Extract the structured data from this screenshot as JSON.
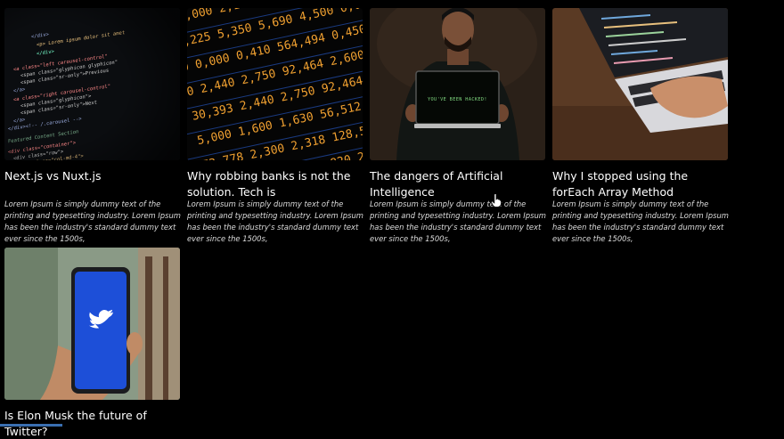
{
  "posts": [
    {
      "title": "Next.js vs Nuxt.js",
      "excerpt": "Lorem Ipsum is simply dummy text of the printing and typesetting industry. Lorem Ipsum has been the industry's standard dummy text ever since the 1500s,",
      "image": "code-editor-screenshot"
    },
    {
      "title": "Why robbing banks is not the solution. Tech is",
      "excerpt": "Lorem Ipsum is simply dummy text of the printing and typesetting industry. Lorem Ipsum has been the industry's standard dummy text ever since the 1500s,",
      "image": "stock-ticker-board"
    },
    {
      "title": "The dangers of Artificial Intelligence",
      "excerpt": "Lorem Ipsum is simply dummy text of the printing and typesetting industry. Lorem Ipsum has been the industry's standard dummy text ever since the 1500s,",
      "image": "man-holding-hacked-laptop",
      "image_text": "YOU'VE BEEN HACKED!"
    },
    {
      "title": "Why I stopped using the forEach Array Method",
      "excerpt": "Lorem Ipsum is simply dummy text of the printing and typesetting industry. Lorem Ipsum has been the industry's standard dummy text ever since the 1500s,",
      "image": "hands-typing-laptop"
    },
    {
      "title": "Is Elon Musk the future of Twitter?",
      "excerpt": "",
      "image": "phone-twitter-logo"
    }
  ],
  "colors": {
    "background": "#000000",
    "text": "#ffffff",
    "twitter_blue": "#1d4fd8"
  }
}
